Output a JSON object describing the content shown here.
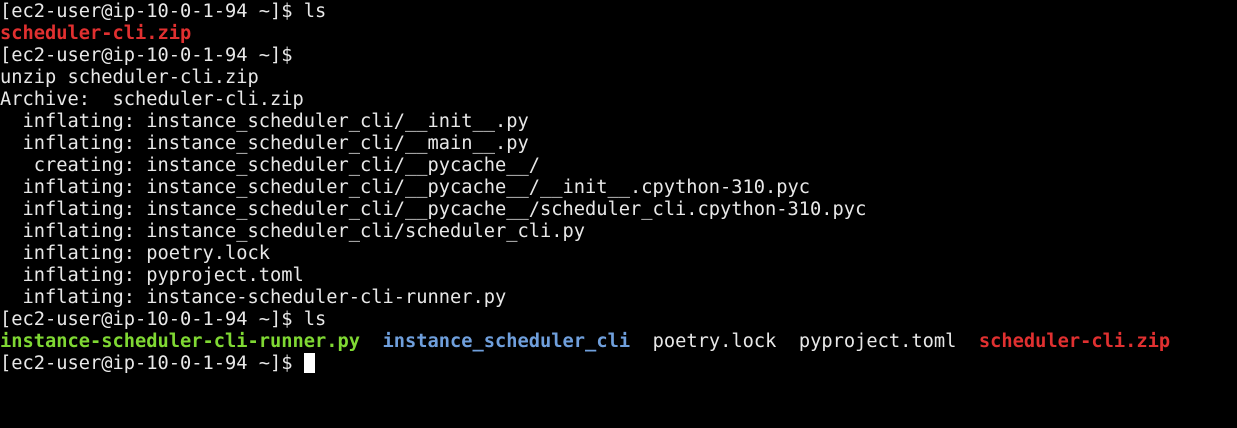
{
  "terminal": {
    "colors": {
      "background": "#000000",
      "text": "#e8e8e8",
      "zip": "#e03030",
      "executable": "#7fd833",
      "directory": "#6f9fdc"
    },
    "lines": [
      {
        "prompt": "[ec2-user@ip-10-0-1-94 ~]$ ",
        "command": "ls"
      },
      {
        "text": "scheduler-cli.zip"
      },
      {
        "prompt": "[ec2-user@ip-10-0-1-94 ~]$"
      },
      {
        "text": "unzip scheduler-cli.zip"
      },
      {
        "text": "Archive:  scheduler-cli.zip"
      },
      {
        "text": "  inflating: instance_scheduler_cli/__init__.py"
      },
      {
        "text": "  inflating: instance_scheduler_cli/__main__.py"
      },
      {
        "text": "   creating: instance_scheduler_cli/__pycache__/"
      },
      {
        "text": "  inflating: instance_scheduler_cli/__pycache__/__init__.cpython-310.pyc"
      },
      {
        "text": "  inflating: instance_scheduler_cli/__pycache__/scheduler_cli.cpython-310.pyc"
      },
      {
        "text": "  inflating: instance_scheduler_cli/scheduler_cli.py"
      },
      {
        "text": "  inflating: poetry.lock"
      },
      {
        "text": "  inflating: pyproject.toml"
      },
      {
        "text": "  inflating: instance-scheduler-cli-runner.py"
      },
      {
        "prompt": "[ec2-user@ip-10-0-1-94 ~]$ ",
        "command": "ls"
      }
    ],
    "listing": [
      {
        "name": "instance-scheduler-cli-runner.py",
        "kind": "executable"
      },
      {
        "name": "instance_scheduler_cli",
        "kind": "directory"
      },
      {
        "name": "poetry.lock",
        "kind": "file"
      },
      {
        "name": "pyproject.toml",
        "kind": "file"
      },
      {
        "name": "scheduler-cli.zip",
        "kind": "archive"
      }
    ],
    "final_prompt": "[ec2-user@ip-10-0-1-94 ~]$ "
  }
}
